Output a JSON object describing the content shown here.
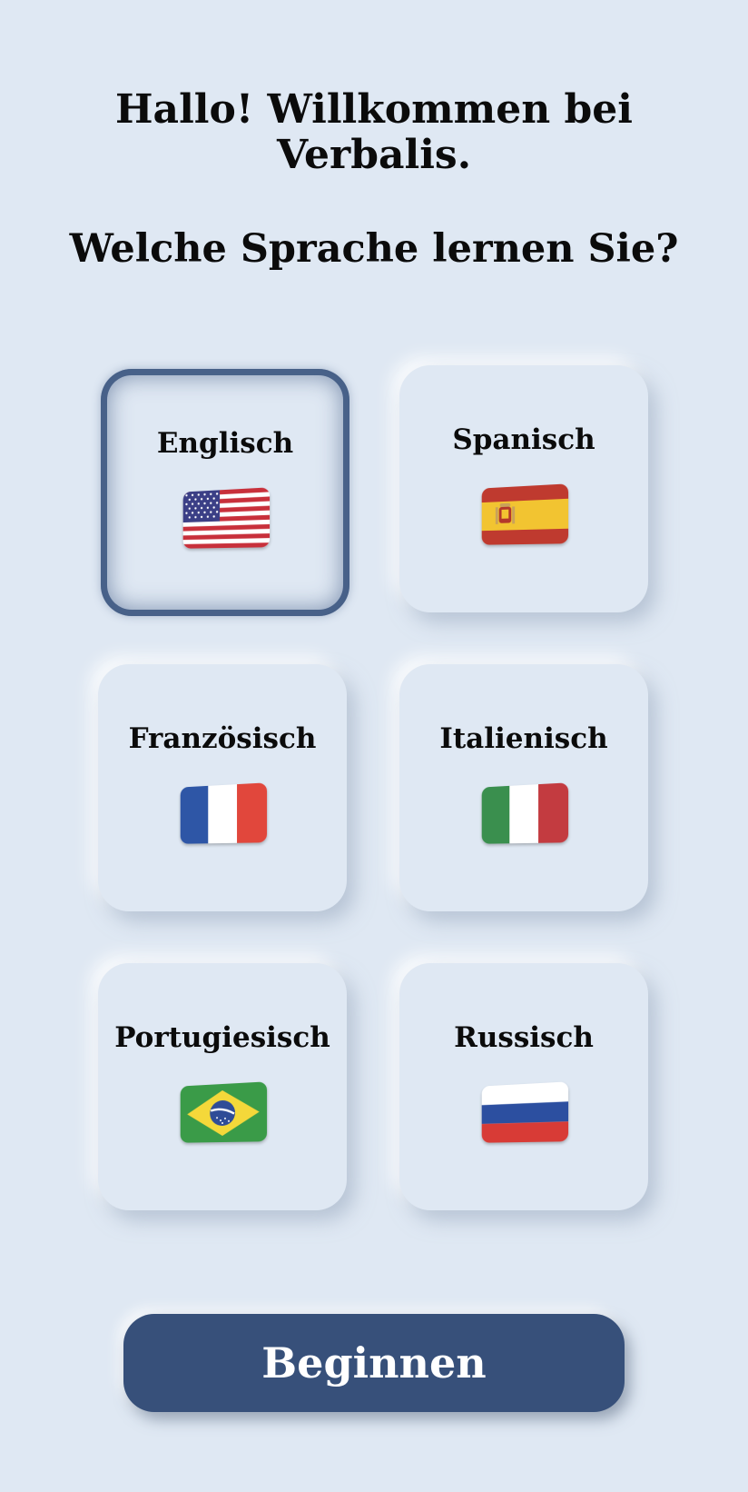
{
  "header": {
    "greeting_line1": "Hallo! Willkommen bei",
    "greeting_line2": "Verbalis.",
    "question": "Welche Sprache lernen Sie?"
  },
  "languages": [
    {
      "label": "Englisch",
      "flag_icon": "us-flag-icon",
      "selected": true
    },
    {
      "label": "Spanisch",
      "flag_icon": "spain-flag-icon",
      "selected": false
    },
    {
      "label": "Französisch",
      "flag_icon": "france-flag-icon",
      "selected": false
    },
    {
      "label": "Italienisch",
      "flag_icon": "italy-flag-icon",
      "selected": false
    },
    {
      "label": "Portugiesisch",
      "flag_icon": "brazil-flag-icon",
      "selected": false
    },
    {
      "label": "Russisch",
      "flag_icon": "russia-flag-icon",
      "selected": false
    }
  ],
  "start_button": {
    "label": "Beginnen"
  },
  "colors": {
    "background": "#dfe8f3",
    "accent": "#37507a",
    "selected_border": "#405a83",
    "text": "#0b0b0b"
  }
}
